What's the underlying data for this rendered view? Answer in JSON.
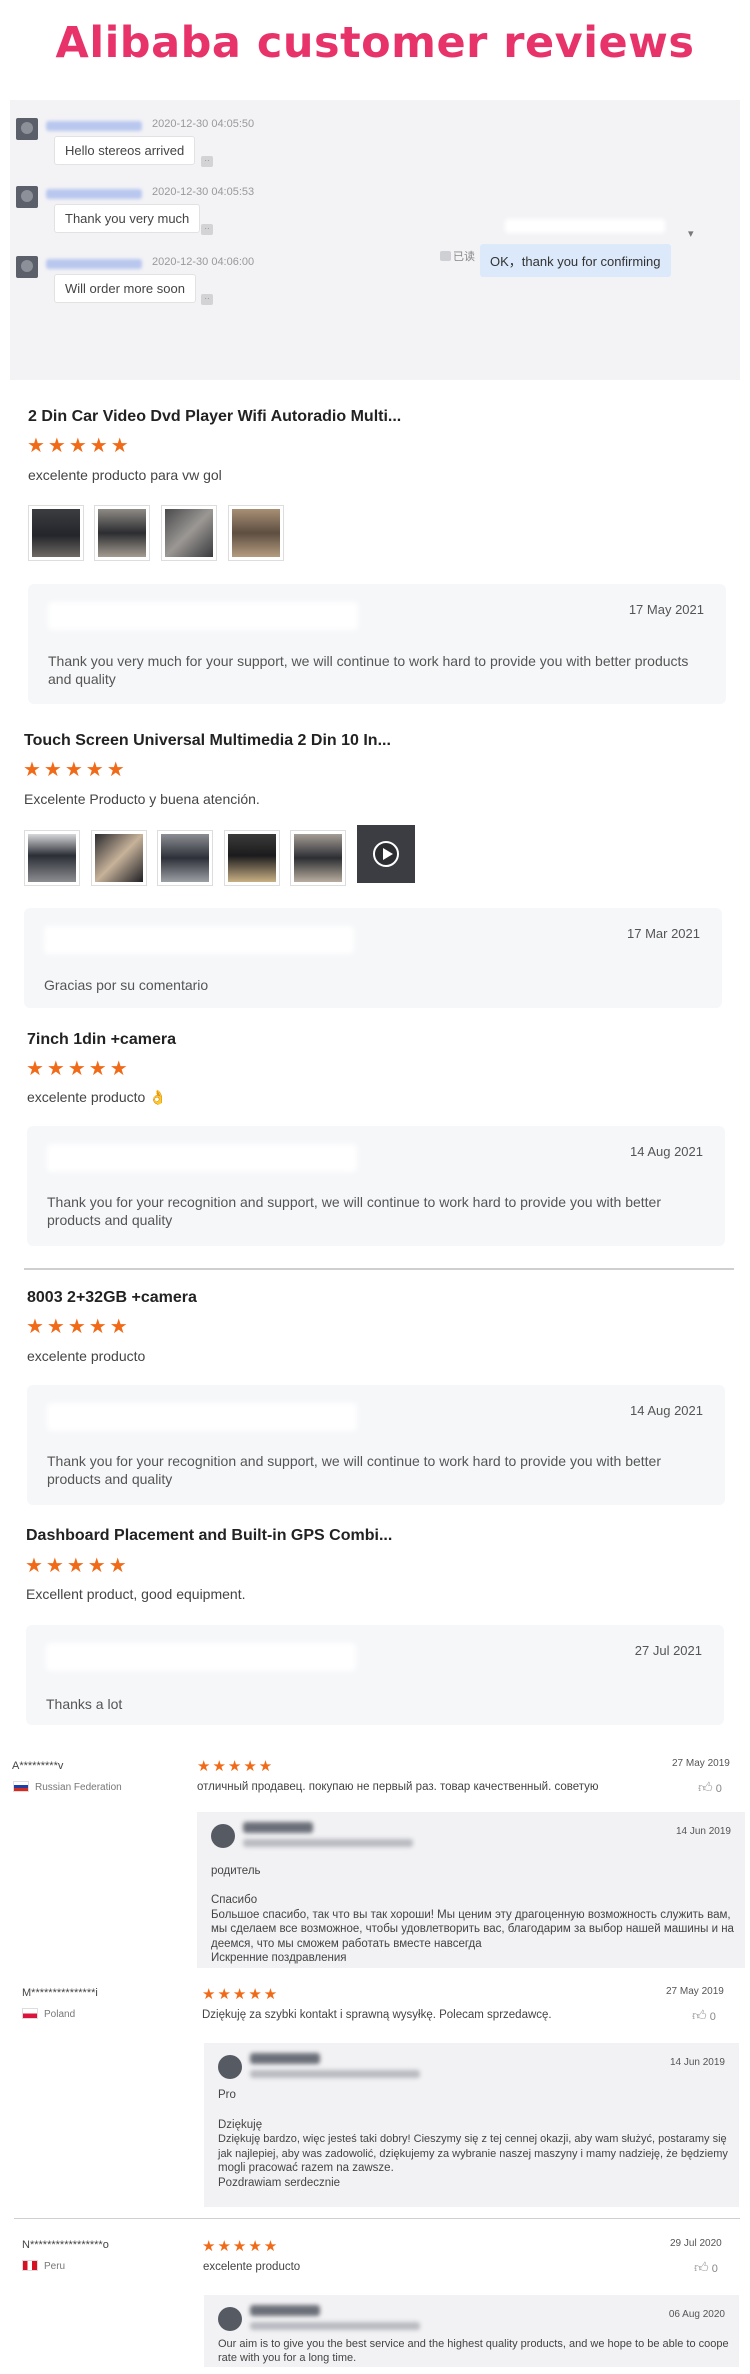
{
  "header": {
    "title": "Alibaba customer reviews"
  },
  "chat": {
    "messages": [
      {
        "time": "2020-12-30 04:05:50",
        "text": "Hello stereos arrived"
      },
      {
        "time": "2020-12-30 04:05:53",
        "text": "Thank you very much"
      },
      {
        "time": "2020-12-30 04:06:00",
        "text": "Will order more soon"
      }
    ],
    "reply": {
      "read_label": "已读",
      "text": "OK，thank you for confirming"
    }
  },
  "reviews": [
    {
      "title": "2 Din Car Video Dvd Player Wifi Autoradio Multi...",
      "stars": "★★★★★",
      "rating": 5,
      "text": "excelente producto para vw gol",
      "reply_date": "17 May 2021",
      "reply_text": "Thank you very much for your support, we will continue to work hard to provide you with better products and quality"
    },
    {
      "title": "Touch Screen Universal Multimedia 2 Din 10 In...",
      "stars": "★★★★★",
      "rating": 5,
      "text": "Excelente Producto y buena atención.",
      "reply_date": "17 Mar 2021",
      "reply_text": "Gracias por su comentario"
    },
    {
      "title": "7inch 1din +camera",
      "stars": "★★★★★",
      "rating": 5,
      "text": "excelente producto 👌",
      "reply_date": "14 Aug 2021",
      "reply_text": "Thank you for your recognition and support, we will continue to work hard to provide you with better products and quality"
    },
    {
      "title": "8003 2+32GB +camera",
      "stars": "★★★★★",
      "rating": 5,
      "text": "excelente producto",
      "reply_date": "14 Aug 2021",
      "reply_text": "Thank you for your recognition and support, we will continue to work hard to provide you with better products and quality"
    },
    {
      "title": "Dashboard Placement and Built-in GPS Combi...",
      "stars": "★★★★★",
      "rating": 5,
      "text": "Excellent product, good equipment.",
      "reply_date": "27 Jul 2021",
      "reply_text": "Thanks a lot"
    }
  ],
  "old_reviews": [
    {
      "user": "A*********v",
      "country": "Russian Federation",
      "stars": "★★★★★",
      "rating": 5,
      "date": "27 May 2019",
      "likes": "0",
      "text": "отличный продавец. покупаю не первый раз. товар качественный. советую",
      "reply_date": "14 Jun 2019",
      "reply_lines": [
        "родитель",
        "",
        "Спасибо",
        "Большое спасибо, так что вы так хороши! Мы ценим эту драгоценную возможность служить вам,",
        "мы сделаем все возможное, чтобы удовлетворить вас, благодарим за выбор нашей машины и на",
        "деемся, что мы сможем работать вместе навсегда",
        "Искренние поздравления"
      ]
    },
    {
      "user": "M***************i",
      "country": "Poland",
      "stars": "★★★★★",
      "rating": 5,
      "date": "27 May 2019",
      "likes": "0",
      "text": "Dziękuję za szybki kontakt i sprawną wysyłkę. Polecam sprzedawcę.",
      "reply_date": "14 Jun 2019",
      "reply_lines": [
        "Pro",
        "",
        "Dziękuję",
        "Dziękuję bardzo, więc jesteś taki dobry! Cieszymy się z tej cennej okazji, aby wam służyć, postaramy się",
        "jak najlepiej, aby was zadowolić, dziękujemy za wybranie naszej maszyny i mamy nadzieję, że będziemy",
        "mogli pracować razem na zawsze.",
        "Pozdrawiam serdecznie"
      ]
    },
    {
      "user": "N*****************o",
      "country": "Peru",
      "stars": "★★★★★",
      "rating": 5,
      "date": "29 Jul 2020",
      "likes": "0",
      "text": "excelente producto",
      "reply_date": "06 Aug 2020",
      "reply_lines": [
        "Our aim is to give you the best service and the highest quality products, and we hope to be able to coope",
        "rate with you for a long time."
      ]
    }
  ],
  "icons": {
    "thumbs_up": "thumbs-up-icon",
    "play": "play-icon"
  },
  "colors": {
    "title": "#e8336a",
    "stars": "#f06a18",
    "chat_bubble_self": "#dbe9fa"
  }
}
